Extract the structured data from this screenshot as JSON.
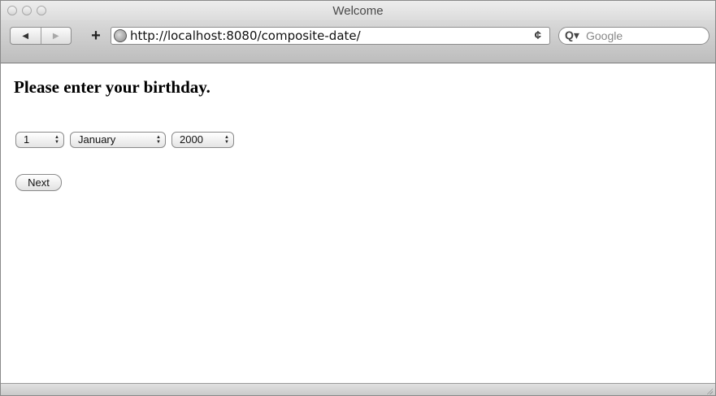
{
  "window": {
    "title": "Welcome"
  },
  "toolbar": {
    "back_icon": "back-arrow-icon",
    "forward_icon": "forward-arrow-icon",
    "add_icon": "plus-icon",
    "url": "http://localhost:8080/composite-date/",
    "reload_icon": "reload-icon",
    "search_placeholder": "Google"
  },
  "page": {
    "heading": "Please enter your birthday.",
    "day": {
      "selected": "1"
    },
    "month": {
      "selected": "January"
    },
    "year": {
      "selected": "2000"
    },
    "next_label": "Next"
  }
}
